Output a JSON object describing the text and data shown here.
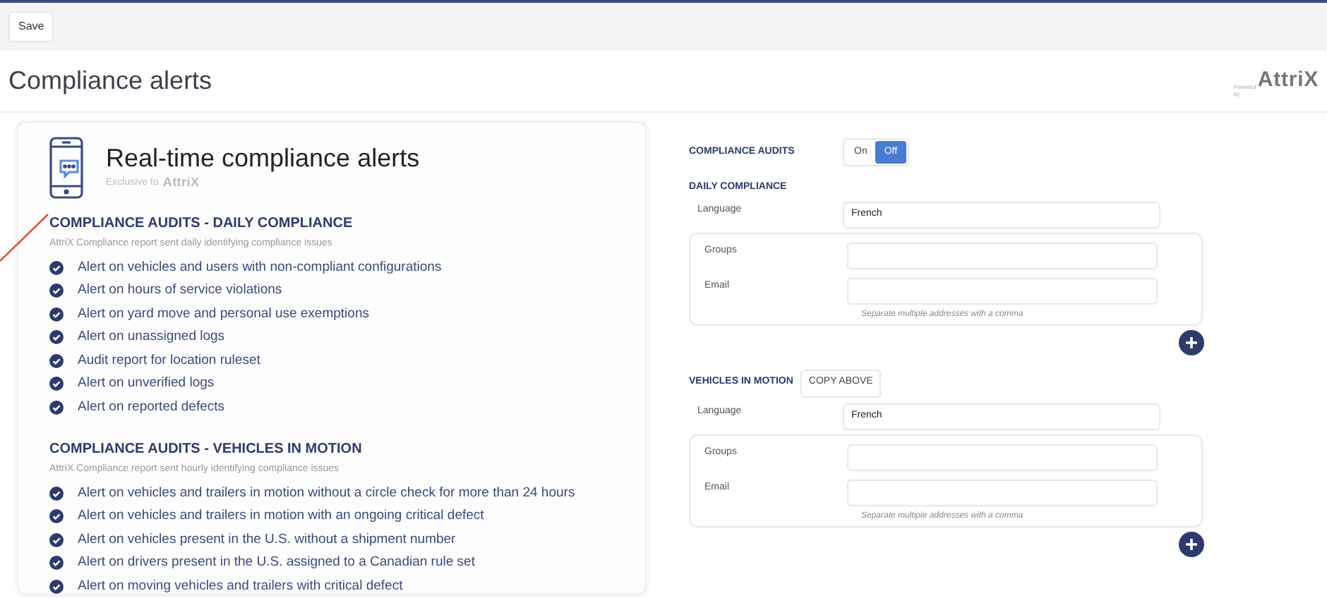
{
  "toolbar": {
    "save_button": "Save"
  },
  "page": {
    "title": "Compliance alerts",
    "powered_by": "Powered by",
    "logo": "AttriX"
  },
  "feature_card": {
    "title": "Real-time compliance alerts",
    "exclusive_label": "Exclusive to",
    "exclusive_logo": "AttriX",
    "sections": [
      {
        "heading": "COMPLIANCE AUDITS - DAILY COMPLIANCE",
        "description": "AttriX Compliance report sent daily identifying compliance issues",
        "items": [
          {
            "text": "Alert on vehicles and users with non-compliant configurations",
            "checked": true
          },
          {
            "text": "Alert on hours of service violations",
            "checked": true
          },
          {
            "text": "Alert on yard move and personal use exemptions",
            "checked": true
          },
          {
            "text": "Alert on unassigned logs",
            "checked": true
          },
          {
            "text": "Audit report for location ruleset",
            "checked": true
          },
          {
            "text": "Alert on unverified logs",
            "checked": true
          },
          {
            "text": "Alert on reported defects",
            "checked": true
          }
        ]
      },
      {
        "heading": "COMPLIANCE AUDITS - VEHICLES IN MOTION",
        "description": "AttriX Compliance report sent hourly identifying compliance issues",
        "items": [
          {
            "text": "Alert on vehicles and trailers in motion without a circle check for more than 24 hours",
            "checked": true
          },
          {
            "text": "Alert on vehicles and trailers in motion with an ongoing critical defect",
            "checked": true
          },
          {
            "text": "Alert on vehicles present in the U.S. without a shipment number",
            "checked": true
          },
          {
            "text": "Alert on drivers present in the U.S. assigned to a Canadian rule set",
            "checked": true
          },
          {
            "text": "Alert on moving vehicles and trailers with critical defect",
            "checked": true
          }
        ]
      }
    ]
  },
  "settings": {
    "compliance_audits": {
      "label": "COMPLIANCE AUDITS",
      "options": [
        {
          "label": "On",
          "selected": false
        },
        {
          "label": "Off",
          "selected": true
        }
      ]
    },
    "groups": [
      {
        "heading": "DAILY COMPLIANCE",
        "language": {
          "label": "Language",
          "value": "French"
        },
        "fields": [
          {
            "label": "Groups"
          },
          {
            "label": "Email"
          }
        ],
        "hint": "Separate multiple addresses with a comma"
      },
      {
        "heading": "VEHICLES IN MOTION",
        "copy_button": "COPY ABOVE",
        "language": {
          "label": "Language",
          "value": "French"
        },
        "fields": [
          {
            "label": "Groups"
          },
          {
            "label": "Email"
          }
        ],
        "hint": "Separate multiple addresses with a comma"
      }
    ]
  }
}
